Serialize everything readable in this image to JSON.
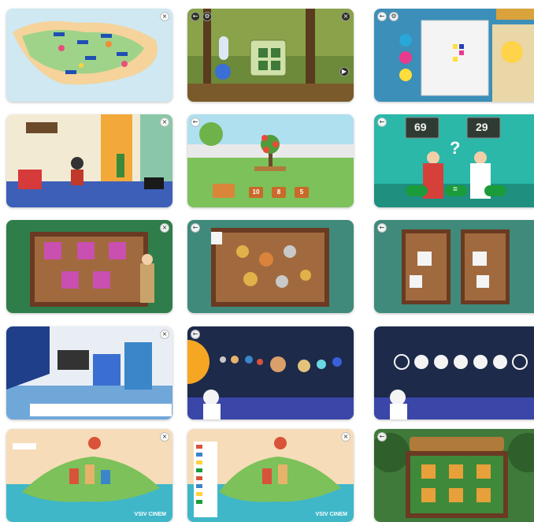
{
  "controls": {
    "close_glyph": "×",
    "back_glyph": "←",
    "settings_glyph": "⚙"
  },
  "cards": {
    "c5": {
      "numbers": [
        "10",
        "8",
        "5"
      ]
    },
    "c6": {
      "left": "69",
      "right": "29",
      "mid_symbol": "=",
      "question": "?"
    },
    "c15": {
      "caption": "VSIV CINEM"
    },
    "c16": {
      "caption": "VSIV CINEM"
    }
  },
  "icons": {
    "close": "close-icon",
    "back": "arrow-left-icon",
    "settings": "gear-icon",
    "play": "play-icon"
  }
}
